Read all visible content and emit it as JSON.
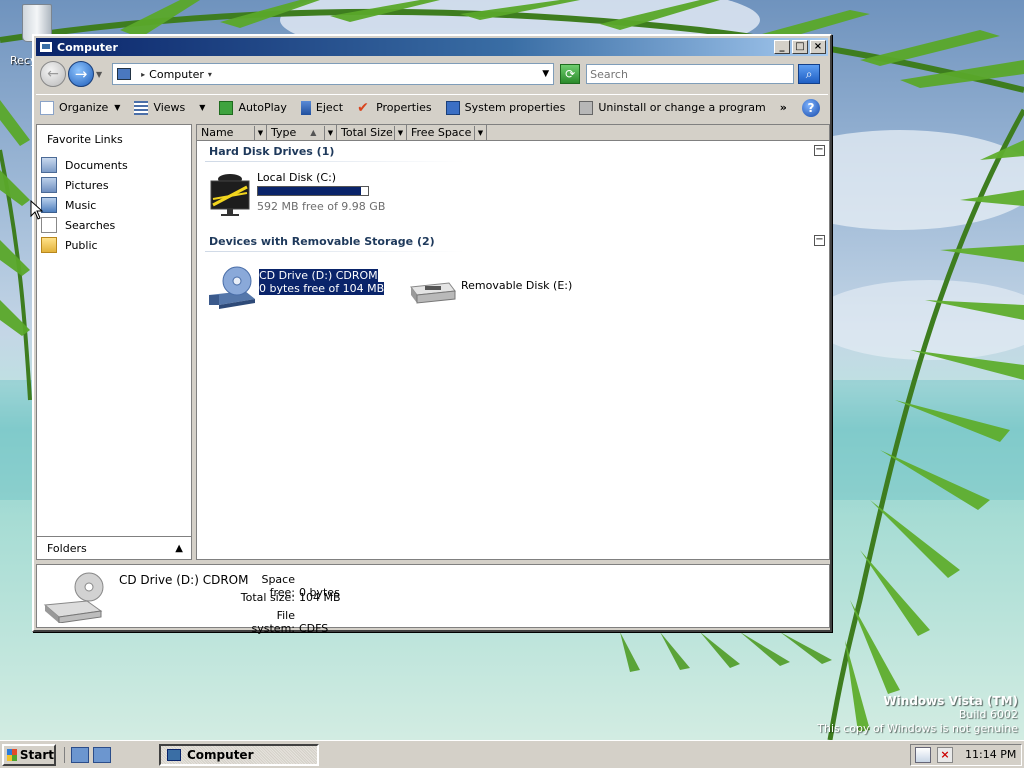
{
  "desktop": {
    "recycle_bin_label": "Recycle Bin",
    "watermark": {
      "line1": "Windows Vista (TM)",
      "line2": "Build 6002",
      "line3": "This copy of Windows is not genuine"
    }
  },
  "window": {
    "title": "Computer",
    "controls": {
      "minimize": "_",
      "maximize": "□",
      "close": "×"
    },
    "address": {
      "location_icon": "computer-icon",
      "location_label": "Computer"
    },
    "search": {
      "placeholder": "Search"
    },
    "toolbar": {
      "organize": "Organize",
      "views": "Views",
      "autoplay": "AutoPlay",
      "eject": "Eject",
      "properties": "Properties",
      "system_properties": "System properties",
      "uninstall": "Uninstall or change a program",
      "more": "»",
      "help": "?"
    },
    "left_pane": {
      "heading": "Favorite Links",
      "links": [
        {
          "label": "Documents",
          "icon": "documents-icon"
        },
        {
          "label": "Pictures",
          "icon": "pictures-icon"
        },
        {
          "label": "Music",
          "icon": "music-icon"
        },
        {
          "label": "Searches",
          "icon": "searches-icon"
        },
        {
          "label": "Public",
          "icon": "public-folder-icon"
        }
      ],
      "folders_label": "Folders"
    },
    "columns": [
      "Name",
      "Type",
      "Total Size",
      "Free Space"
    ],
    "groups": [
      {
        "title": "Hard Disk Drives (1)",
        "items": [
          {
            "name": "Local Disk (C:)",
            "detail": "592 MB free of 9.98 GB",
            "used_fraction": 0.94,
            "icon": "hard-disk-icon"
          }
        ]
      },
      {
        "title": "Devices with Removable Storage (2)",
        "items": [
          {
            "name": "CD Drive (D:) CDROM",
            "detail": "0 bytes free of 104 MB",
            "icon": "cd-drive-icon",
            "selected": true
          },
          {
            "name": "Removable Disk (E:)",
            "icon": "removable-disk-icon"
          }
        ]
      }
    ],
    "details": {
      "name": "CD Drive (D:) CDROM",
      "space_free_label": "Space free:",
      "space_free": "0 bytes",
      "total_size_label": "Total size:",
      "total_size": "104 MB",
      "file_system_label": "File system:",
      "file_system": "CDFS"
    }
  },
  "taskbar": {
    "start_label": "Start",
    "task_label": "Computer",
    "clock": "11:14 PM"
  },
  "colors": {
    "selection": "#0a246a",
    "titlebar_start": "#0a246a",
    "titlebar_end": "#a6caf0",
    "chrome": "#d4d0c8"
  }
}
